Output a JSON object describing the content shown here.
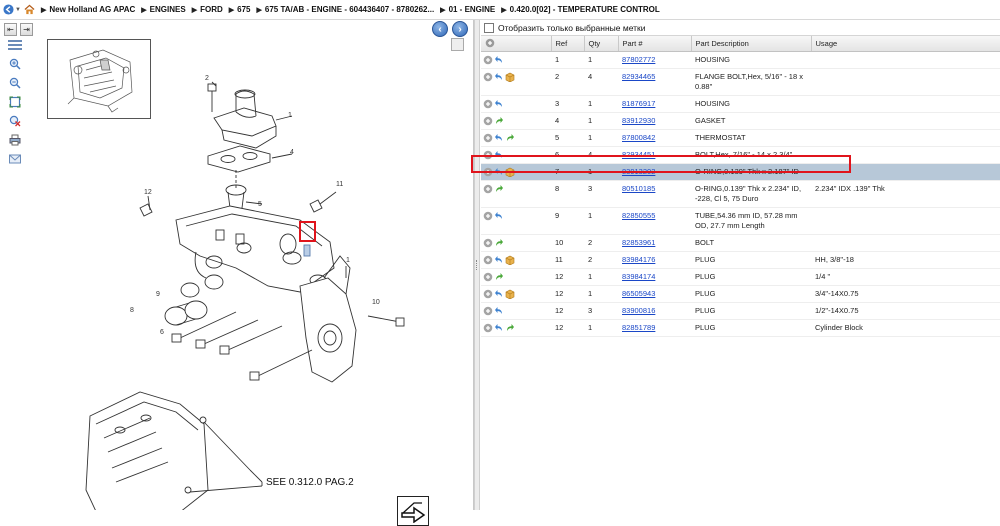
{
  "breadcrumb": [
    "New Holland AG APAC",
    "ENGINES",
    "FORD",
    "675",
    "675 TA/AB - ENGINE - 604436407 - 8780262...",
    "01 - ENGINE",
    "0.420.0[02] - TEMPERATURE CONTROL"
  ],
  "filter_label": "Отобразить только выбранные метки",
  "drawing_note": "SEE 0.312.0 PAG.2",
  "callouts": [
    "1",
    "2",
    "3",
    "4",
    "5",
    "6",
    "7",
    "8",
    "9",
    "10",
    "11",
    "12"
  ],
  "columns": {
    "ref": "Ref",
    "qty": "Qty",
    "part": "Part #",
    "desc": "Part Description",
    "usage": "Usage"
  },
  "rows": [
    {
      "ref": "1",
      "qty": "1",
      "part": "87802772",
      "desc": "HOUSING",
      "usage": "",
      "icons": [
        "plus-icon",
        "undo-icon"
      ]
    },
    {
      "ref": "2",
      "qty": "4",
      "part": "82934465",
      "desc": "FLANGE BOLT,Hex, 5/16\" - 18 x 0.88\"",
      "usage": "",
      "icons": [
        "plus-icon",
        "undo-icon",
        "box-icon"
      ]
    },
    {
      "ref": "3",
      "qty": "1",
      "part": "81876917",
      "desc": "HOUSING",
      "usage": "",
      "icons": [
        "plus-icon",
        "undo-icon"
      ]
    },
    {
      "ref": "4",
      "qty": "1",
      "part": "83912930",
      "desc": "GASKET",
      "usage": "",
      "icons": [
        "plus-icon",
        "redo-icon"
      ]
    },
    {
      "ref": "5",
      "qty": "1",
      "part": "87800842",
      "desc": "THERMOSTAT",
      "usage": "",
      "icons": [
        "plus-icon",
        "undo-icon",
        "redo-icon"
      ]
    },
    {
      "ref": "6",
      "qty": "4",
      "part": "82934451",
      "desc": "BOLT,Hex, 7/16\" - 14 x 2 3/4\"",
      "usage": "",
      "icons": [
        "plus-icon",
        "undo-icon"
      ]
    },
    {
      "ref": "7",
      "qty": "1",
      "part": "83913202",
      "desc": "O-RING,0.139\" Thk x 2.187\" ID",
      "usage": "",
      "icons": [
        "plus-icon",
        "undo-icon",
        "box-icon"
      ],
      "selected": true
    },
    {
      "ref": "8",
      "qty": "3",
      "part": "80510185",
      "desc": "O-RING,0.139\" Thk x 2.234\" ID, -228, Cl 5, 75 Duro",
      "usage": "2.234\" IDX .139\" Thk",
      "icons": [
        "plus-icon",
        "redo-icon"
      ]
    },
    {
      "ref": "9",
      "qty": "1",
      "part": "82850555",
      "desc": "TUBE,54.36 mm ID, 57.28 mm OD, 27.7 mm Length",
      "usage": "",
      "icons": [
        "plus-icon",
        "undo-icon"
      ]
    },
    {
      "ref": "10",
      "qty": "2",
      "part": "82853961",
      "desc": "BOLT",
      "usage": "",
      "icons": [
        "plus-icon",
        "redo-icon"
      ]
    },
    {
      "ref": "11",
      "qty": "2",
      "part": "83984176",
      "desc": "PLUG",
      "usage": "HH, 3/8\"-18",
      "icons": [
        "plus-icon",
        "undo-icon",
        "box-icon"
      ]
    },
    {
      "ref": "12",
      "qty": "1",
      "part": "83984174",
      "desc": "PLUG",
      "usage": "1/4 \"",
      "icons": [
        "plus-icon",
        "redo-icon"
      ]
    },
    {
      "ref": "12",
      "qty": "1",
      "part": "86505943",
      "desc": "PLUG",
      "usage": "3/4\"-14X0.75",
      "icons": [
        "plus-icon",
        "undo-icon",
        "box-icon"
      ]
    },
    {
      "ref": "12",
      "qty": "3",
      "part": "83900816",
      "desc": "PLUG",
      "usage": "1/2\"-14X0.75",
      "icons": [
        "plus-icon",
        "undo-icon"
      ]
    },
    {
      "ref": "12",
      "qty": "1",
      "part": "82851789",
      "desc": "PLUG",
      "usage": "Cylinder Block",
      "icons": [
        "plus-icon",
        "undo-icon",
        "redo-icon"
      ]
    }
  ],
  "colors": {
    "selected_row": "#b7c8d8",
    "highlight": "#e0141c",
    "link": "#1a47c7"
  }
}
